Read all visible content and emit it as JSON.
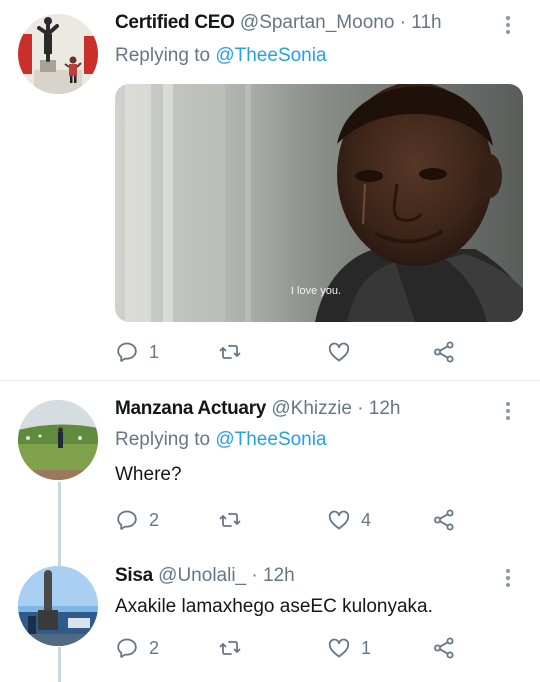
{
  "tweets": [
    {
      "name": "Certified CEO",
      "handle": "@Spartan_Moono",
      "dot": "·",
      "time": "11h",
      "replying_prefix": "Replying to ",
      "replying_to": "@TheeSonia",
      "media_caption": "I love you.",
      "reply_count": "1",
      "retweet_count": "",
      "like_count": ""
    },
    {
      "name": "Manzana Actuary",
      "handle": "@Khizzie",
      "dot": "·",
      "time": "12h",
      "replying_prefix": "Replying to ",
      "replying_to": "@TheeSonia",
      "text": "Where?",
      "reply_count": "2",
      "retweet_count": "",
      "like_count": "4"
    },
    {
      "name": "Sisa",
      "handle": "@Unolali_",
      "dot": "·",
      "time": "12h",
      "text": "Axakile lamaxhego aseEC kulonyaka.",
      "reply_count": "2",
      "retweet_count": "",
      "like_count": "1"
    }
  ],
  "icons": {
    "reply": "reply-icon",
    "retweet": "retweet-icon",
    "like": "heart-icon",
    "share": "share-icon",
    "more": "more-vertical-icon"
  },
  "colors": {
    "link": "#1da1f2",
    "secondary_text": "#657786",
    "divider": "#e6ecf0"
  }
}
